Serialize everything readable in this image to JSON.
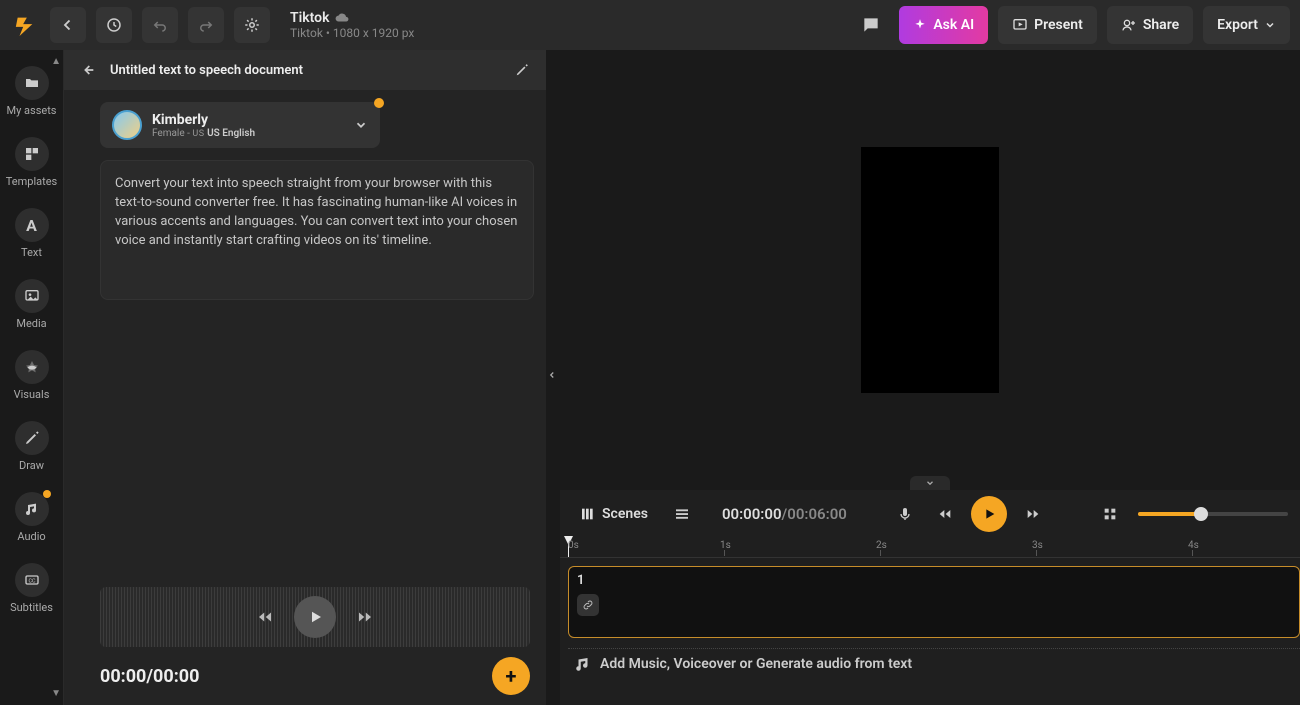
{
  "project": {
    "name": "Tiktok",
    "subtitle": "Tiktok • 1080 x 1920 px"
  },
  "topbar": {
    "askai_label": "Ask AI",
    "present_label": "Present",
    "share_label": "Share",
    "export_label": "Export"
  },
  "rail": {
    "items": [
      {
        "label": "My assets"
      },
      {
        "label": "Templates"
      },
      {
        "label": "Text"
      },
      {
        "label": "Media"
      },
      {
        "label": "Visuals"
      },
      {
        "label": "Draw"
      },
      {
        "label": "Audio"
      },
      {
        "label": "Subtitles"
      }
    ]
  },
  "tts": {
    "doc_title": "Untitled text to speech document",
    "voice_name": "Kimberly",
    "voice_sub_prefix": "Female - ",
    "voice_flag": "US",
    "voice_lang": "US English",
    "text": "Convert your text into speech straight from your browser with this text-to-sound converter free. It has fascinating human-like AI voices in various accents and languages. You can convert text into your chosen voice and instantly start crafting videos on its' timeline.",
    "time": "00:00/00:00"
  },
  "timeline": {
    "scenes_label": "Scenes",
    "current": "00:00:00",
    "duration": "00:06:00",
    "ticks": [
      "0s",
      "1s",
      "2s",
      "3s",
      "4s"
    ],
    "scene_number": "1",
    "audio_hint": "Add Music, Voiceover or Generate audio from text"
  }
}
